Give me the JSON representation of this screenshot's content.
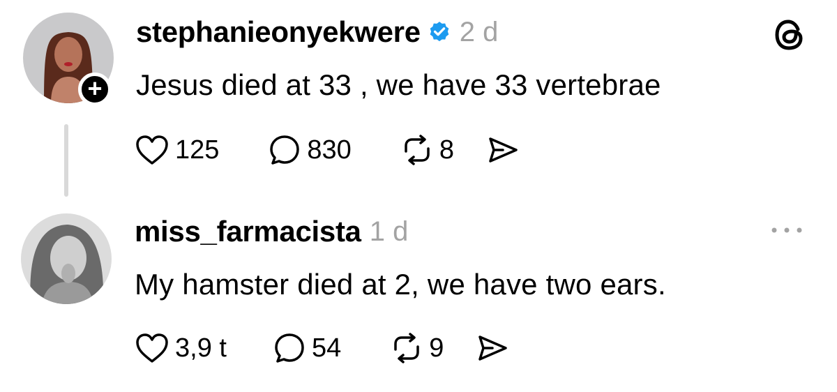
{
  "posts": [
    {
      "username": "stephanieonyekwere",
      "verified": true,
      "time": "2 d",
      "text": "Jesus died at 33 , we have 33 vertebrae",
      "likes": "125",
      "comments": "830",
      "reposts": "8",
      "follow_badge": "+"
    },
    {
      "username": "miss_farmacista",
      "verified": false,
      "time": "1 d",
      "text": "My hamster died at 2, we have two ears.",
      "likes": "3,9 t",
      "comments": "54",
      "reposts": "9"
    }
  ],
  "icons": {
    "app_logo": "threads-logo-icon",
    "verified": "verified-badge-icon",
    "like": "heart-icon",
    "comment": "comment-bubble-icon",
    "repost": "repost-icon",
    "share": "send-icon",
    "more": "more-options-icon"
  },
  "colors": {
    "text": "#000000",
    "muted": "#a3a3a3",
    "verified": "#1d9bf0",
    "thread_line": "#d9d9d9"
  }
}
